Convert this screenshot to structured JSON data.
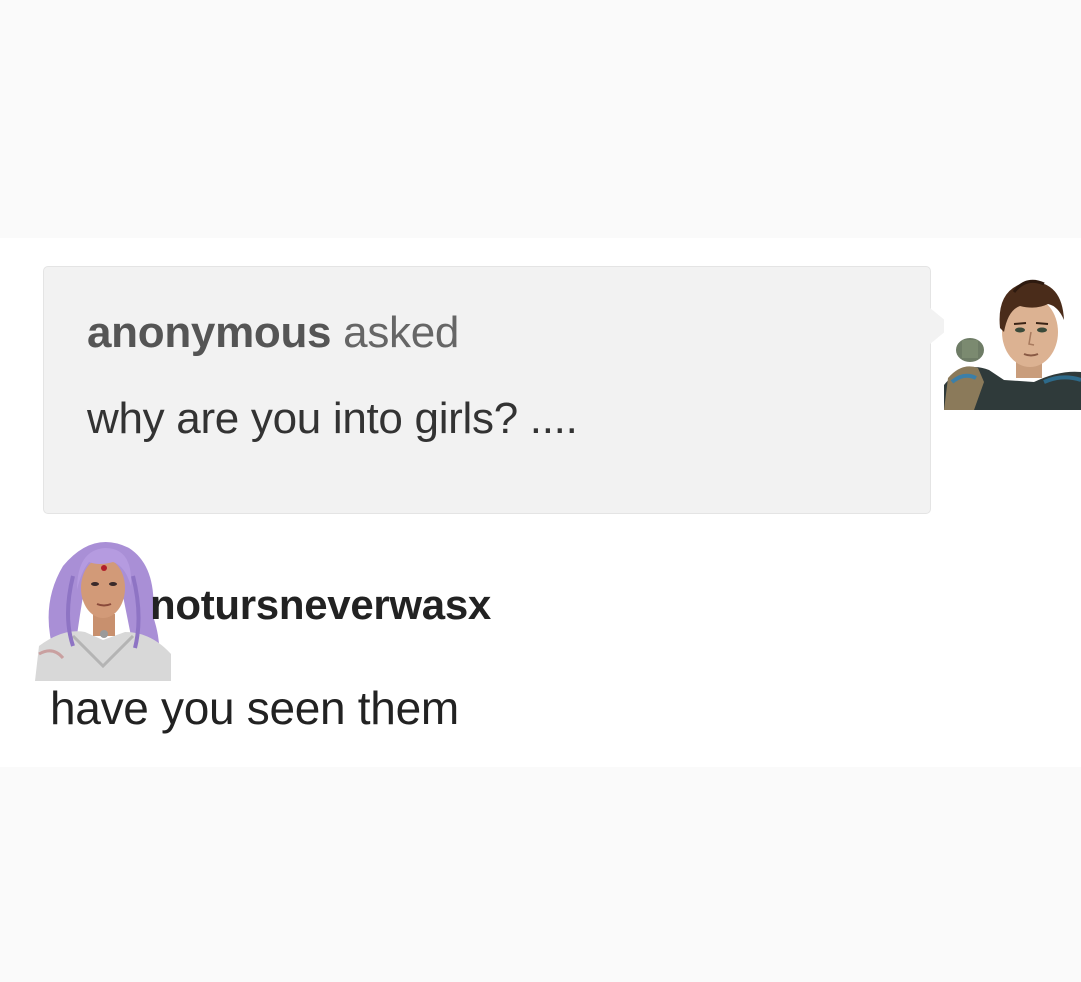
{
  "ask": {
    "asker": "anonymous",
    "verb": "asked",
    "question": "why are you into girls? ...."
  },
  "answer": {
    "username": "notursneverwasx",
    "text": "have you seen them"
  },
  "colors": {
    "page_background": "#fafafa",
    "card_background": "#ffffff",
    "ask_box_background": "#f2f2f2",
    "hair_lavender": "#a98fd6",
    "hair_brown": "#4a2c1a"
  },
  "icons": {
    "right_avatar": "brown-haired-man-avatar-icon",
    "answerer_avatar": "lavender-haired-woman-avatar-icon"
  }
}
